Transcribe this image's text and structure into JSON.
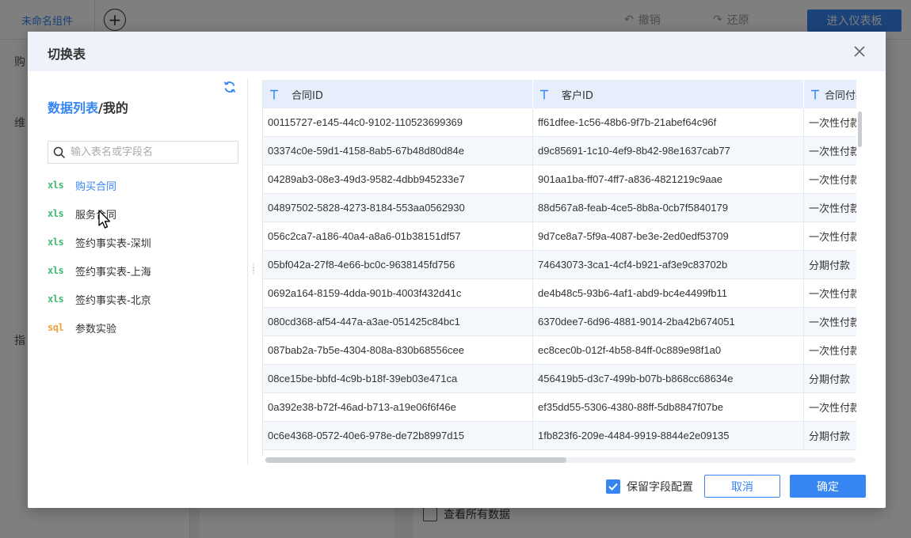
{
  "background": {
    "tab_label": "未命名组件",
    "add_symbol": "+",
    "undo_label": "撤销",
    "redo_label": "还原",
    "enter_dashboard_label": "进入仪表板",
    "left_frag_1": "购",
    "left_frag_2": "维",
    "left_frag_3": "指",
    "view_all_label": "查看所有数据"
  },
  "modal": {
    "title": "切换表",
    "panel_title_blue": "数据列表",
    "panel_title_rest": "/我的",
    "search_placeholder": "输入表名或字段名",
    "tables": [
      {
        "type": "xls",
        "name": "购买合同",
        "active": true
      },
      {
        "type": "xls",
        "name": "服务合同",
        "active": false
      },
      {
        "type": "xls",
        "name": "签约事实表-深圳",
        "active": false
      },
      {
        "type": "xls",
        "name": "签约事实表-上海",
        "active": false
      },
      {
        "type": "xls",
        "name": "签约事实表-北京",
        "active": false
      },
      {
        "type": "sql",
        "name": "参数实验",
        "active": false
      }
    ],
    "columns": [
      "合同ID",
      "客户ID",
      "合同付款类型"
    ],
    "rows": [
      [
        "00115727-e145-44c0-9102-110523699369",
        "ff61dfee-1c56-48b6-9f7b-21abef64c96f",
        "一次性付款"
      ],
      [
        "03374c0e-59d1-4158-8ab5-67b48d80d84e",
        "d9c85691-1c10-4ef9-8b42-98e1637cab77",
        "一次性付款"
      ],
      [
        "04289ab3-08e3-49d3-9582-4dbb945233e7",
        "901aa1ba-ff07-4ff7-a836-4821219c9aae",
        "一次性付款"
      ],
      [
        "04897502-5828-4273-8184-553aa0562930",
        "88d567a8-feab-4ce5-8b8a-0cb7f5840179",
        "一次性付款"
      ],
      [
        "056c2ca7-a186-40a4-a8a6-01b38151df57",
        "9d7ce8a7-5f9a-4087-be3e-2ed0edf53709",
        "一次性付款"
      ],
      [
        "05bf042a-27f8-4e66-bc0c-9638145fd756",
        "74643073-3ca1-4cf4-b921-af3e9c83702b",
        "分期付款"
      ],
      [
        "0692a164-8159-4dda-901b-4003f432d41c",
        "de4b48c5-93b6-4af1-abd9-bc4e4499fb11",
        "一次性付款"
      ],
      [
        "080cd368-af54-447a-a3ae-051425c84bc1",
        "6370dee7-6d96-4881-9014-2ba42b674051",
        "一次性付款"
      ],
      [
        "087bab2a-7b5e-4304-808a-830b68556cee",
        "ec8cec0b-012f-4b58-84ff-0c889e98f1a0",
        "一次性付款"
      ],
      [
        "08ce15be-bbfd-4c9b-b18f-39eb03e471ca",
        "456419b5-d3c7-499b-b07b-b868cc68634e",
        "分期付款"
      ],
      [
        "0a392e38-b72f-46ad-b713-a19e06f6f46e",
        "ef35dd55-5306-4380-88ff-5db8847f07be",
        "一次性付款"
      ],
      [
        "0c6e4368-0572-40e6-978e-de72b8997d15",
        "1fb823f6-209e-4484-9919-8844e2e09135",
        "分期付款"
      ]
    ],
    "keep_config_label": "保留字段配置",
    "keep_config_checked": true,
    "cancel_label": "取消",
    "ok_label": "确定"
  },
  "icons": {
    "close": "close-icon",
    "refresh": "refresh-icon",
    "search": "search-icon",
    "text_type": "text-type-icon",
    "cursor": "mouse-cursor-icon"
  },
  "colors": {
    "accent": "#3685f2",
    "xls": "#3cba73",
    "sql": "#f0a23a",
    "header_bg": "#eef2fa",
    "grid_header_bg": "#e6eefb"
  }
}
